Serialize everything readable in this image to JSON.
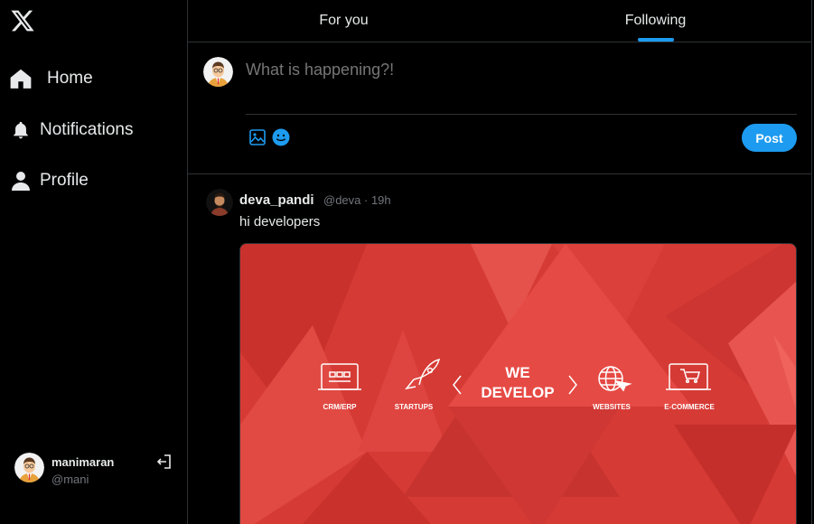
{
  "sidebar": {
    "logo_icon": "x-logo-icon",
    "items": [
      {
        "label": "Home",
        "icon": "home-icon"
      },
      {
        "label": "Notifications",
        "icon": "bell-icon"
      },
      {
        "label": "Profile",
        "icon": "person-icon"
      }
    ],
    "user": {
      "name": "manimaran",
      "handle": "@mani",
      "logout_icon": "logout-icon"
    }
  },
  "tabs": [
    {
      "label": "For you",
      "active": false
    },
    {
      "label": "Following",
      "active": true
    }
  ],
  "composer": {
    "placeholder": "What is happening?!",
    "post_label": "Post",
    "icons": [
      "image-icon",
      "emoji-icon"
    ]
  },
  "post": {
    "author": "deva_pandi",
    "meta": "@deva · 19h",
    "text": "hi developers",
    "image": {
      "headline_line1": "WE",
      "headline_line2": "DEVELOP",
      "items": [
        "CRM/ERP",
        "STARTUPS",
        "WEBSITES",
        "E-COMMERCE"
      ]
    }
  },
  "colors": {
    "accent": "#1d9bf0",
    "background": "#000000",
    "border": "#2f3336",
    "muted_text": "#71767b",
    "banner_red": "#d63a35"
  }
}
